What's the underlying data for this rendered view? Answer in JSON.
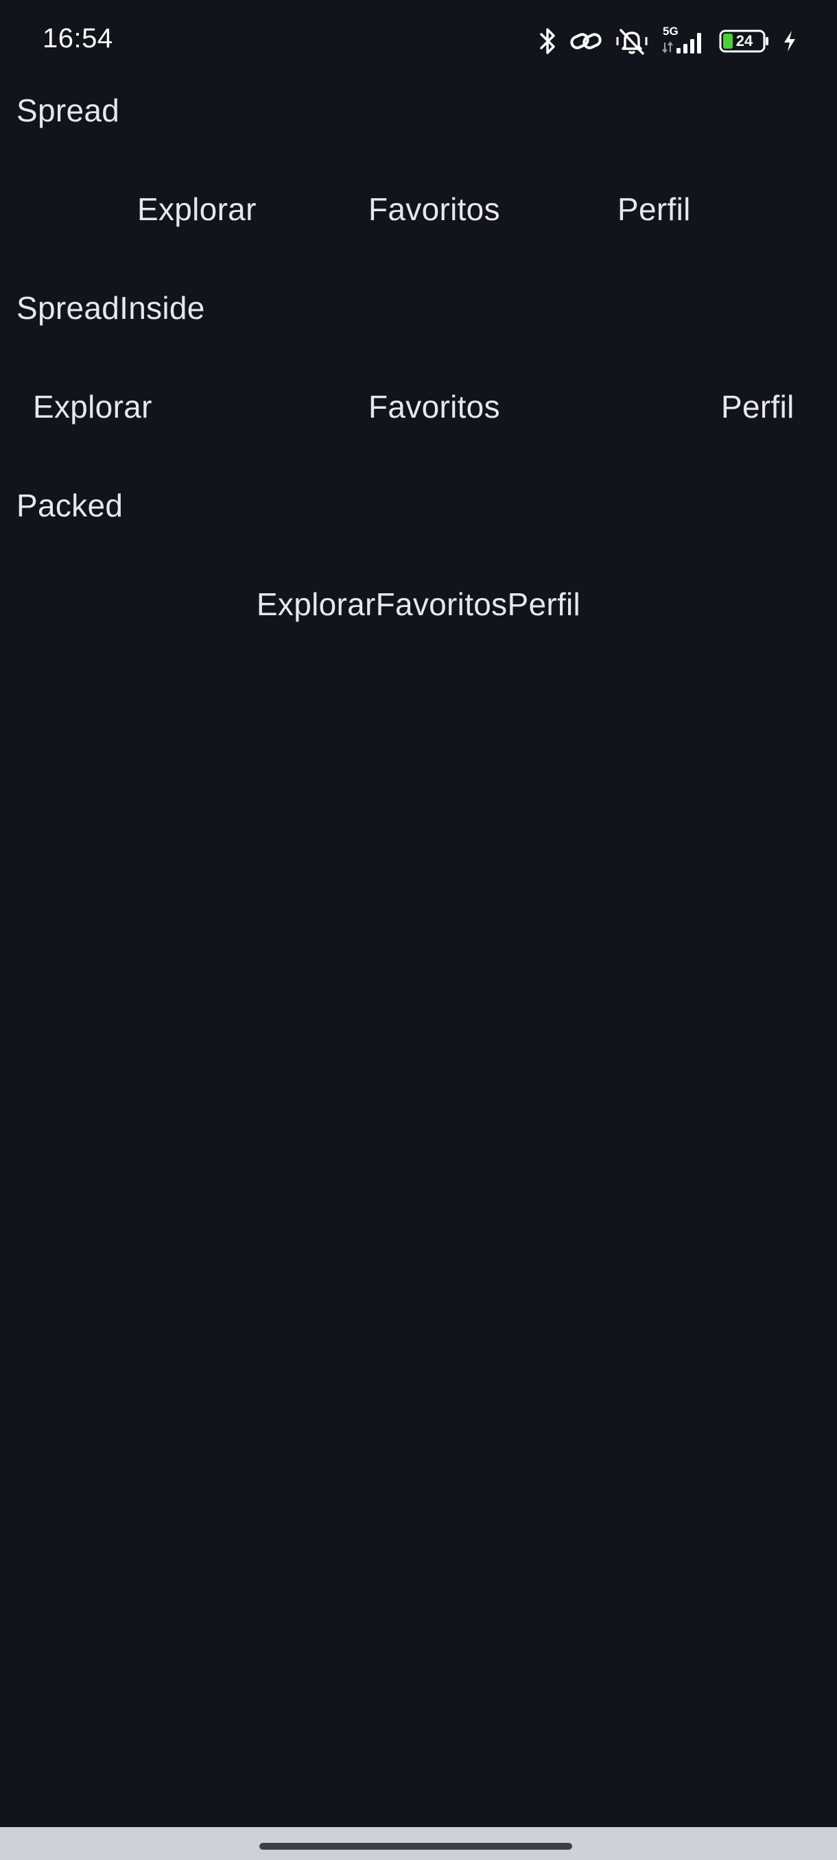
{
  "status_bar": {
    "time": "16:54",
    "network": "5G",
    "battery_level": "24",
    "battery_color": "#4cd137",
    "icons": [
      "bluetooth-icon",
      "link-icon",
      "vibrate-mute-icon",
      "signal-icon",
      "battery-icon",
      "charging-icon"
    ]
  },
  "sections": {
    "spread": {
      "title": "Spread",
      "items": [
        "Explorar",
        "Favoritos",
        "Perfil"
      ]
    },
    "spread_inside": {
      "title": "SpreadInside",
      "items": [
        "Explorar",
        "Favoritos",
        "Perfil"
      ]
    },
    "packed": {
      "title": "Packed",
      "items": [
        "Explorar",
        "Favoritos",
        "Perfil"
      ]
    }
  },
  "colors": {
    "background": "#11141b",
    "text": "#e6e8ee",
    "nav_bar": "#ced2d6"
  }
}
